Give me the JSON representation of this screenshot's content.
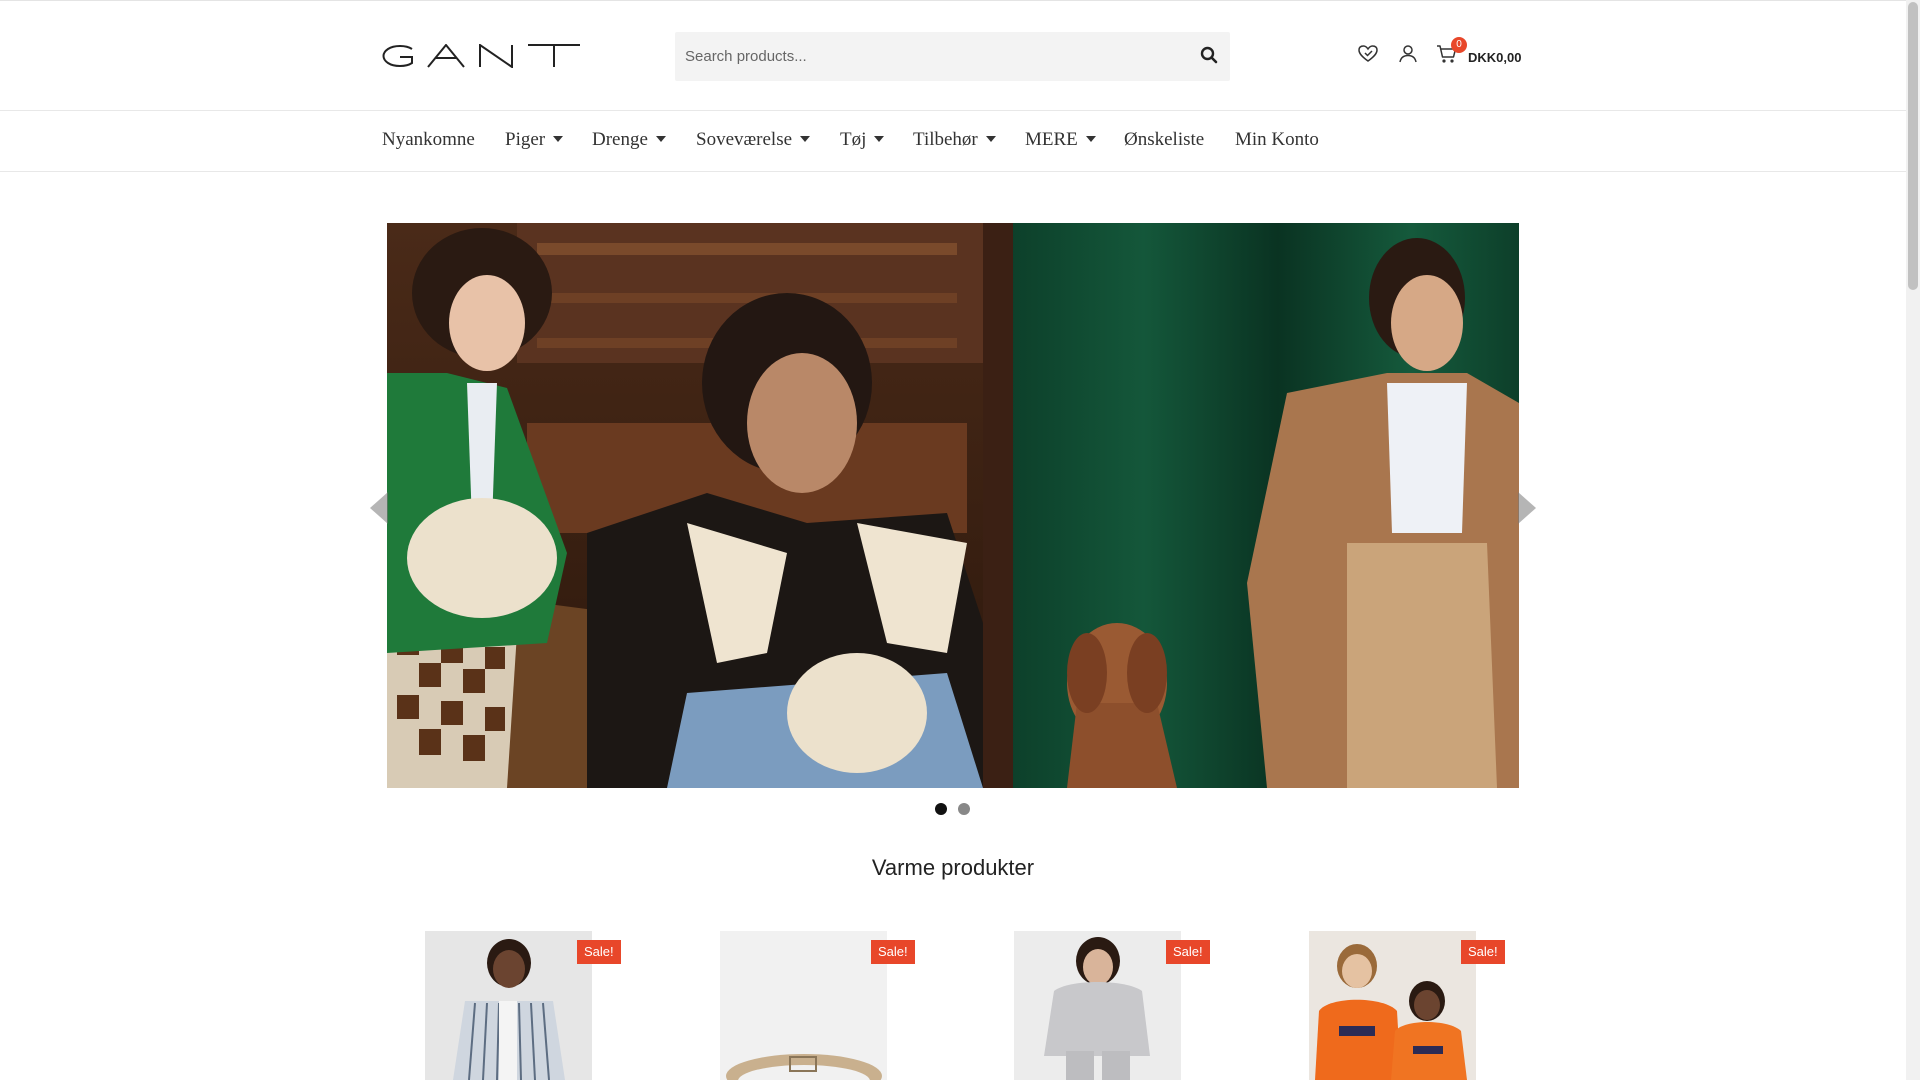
{
  "brand": {
    "logo_text": "GANT"
  },
  "search": {
    "placeholder": "Search products...",
    "value": ""
  },
  "header_icons": [
    "heart-icon",
    "user-icon",
    "cart-icon"
  ],
  "cart": {
    "count": "0",
    "total": "DKK0,00"
  },
  "nav": {
    "items": [
      {
        "label": "Nyankomne",
        "has_dropdown": false
      },
      {
        "label": "Piger",
        "has_dropdown": true
      },
      {
        "label": "Drenge",
        "has_dropdown": true
      },
      {
        "label": "Soveværelse",
        "has_dropdown": true
      },
      {
        "label": "Tøj",
        "has_dropdown": true
      },
      {
        "label": "Tilbehør",
        "has_dropdown": true
      },
      {
        "label": "MERE",
        "has_dropdown": true
      },
      {
        "label": "Ønskeliste",
        "has_dropdown": false
      },
      {
        "label": "Min Konto",
        "has_dropdown": false
      }
    ]
  },
  "hero": {
    "slides": 2,
    "active_slide": 1
  },
  "section": {
    "title": "Varme produkter"
  },
  "products": [
    {
      "badge": "Sale!"
    },
    {
      "badge": "Sale!"
    },
    {
      "badge": "Sale!"
    },
    {
      "badge": "Sale!"
    }
  ],
  "colors": {
    "sale_badge": "#e8472a",
    "accent": "#222222"
  }
}
